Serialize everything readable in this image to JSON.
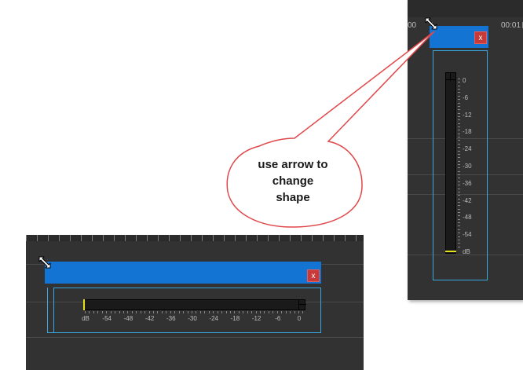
{
  "vertical_meter": {
    "ruler_left": "00",
    "ruler_right": "00:01",
    "close_label": "x",
    "scale": [
      "0",
      "-6",
      "-12",
      "-18",
      "-24",
      "-30",
      "-36",
      "-42",
      "-48",
      "-54",
      "dB"
    ]
  },
  "horizontal_meter": {
    "close_label": "x",
    "scale": [
      "dB",
      "-54",
      "-48",
      "-42",
      "-36",
      "-30",
      "-24",
      "-18",
      "-12",
      "-6",
      "0"
    ]
  },
  "callout": {
    "line1": "use arrow  to",
    "line2": "change",
    "line3": "shape"
  },
  "icons": {
    "resize": "resize-diagonal-icon",
    "close": "close-icon"
  },
  "colors": {
    "title_bar": "#1474d4",
    "close_button": "#c83a3a",
    "meter_border": "#3ba7e0",
    "panel_bg": "#323232",
    "callout_stroke": "#e0474a",
    "level_floor": "#e6e21a"
  }
}
